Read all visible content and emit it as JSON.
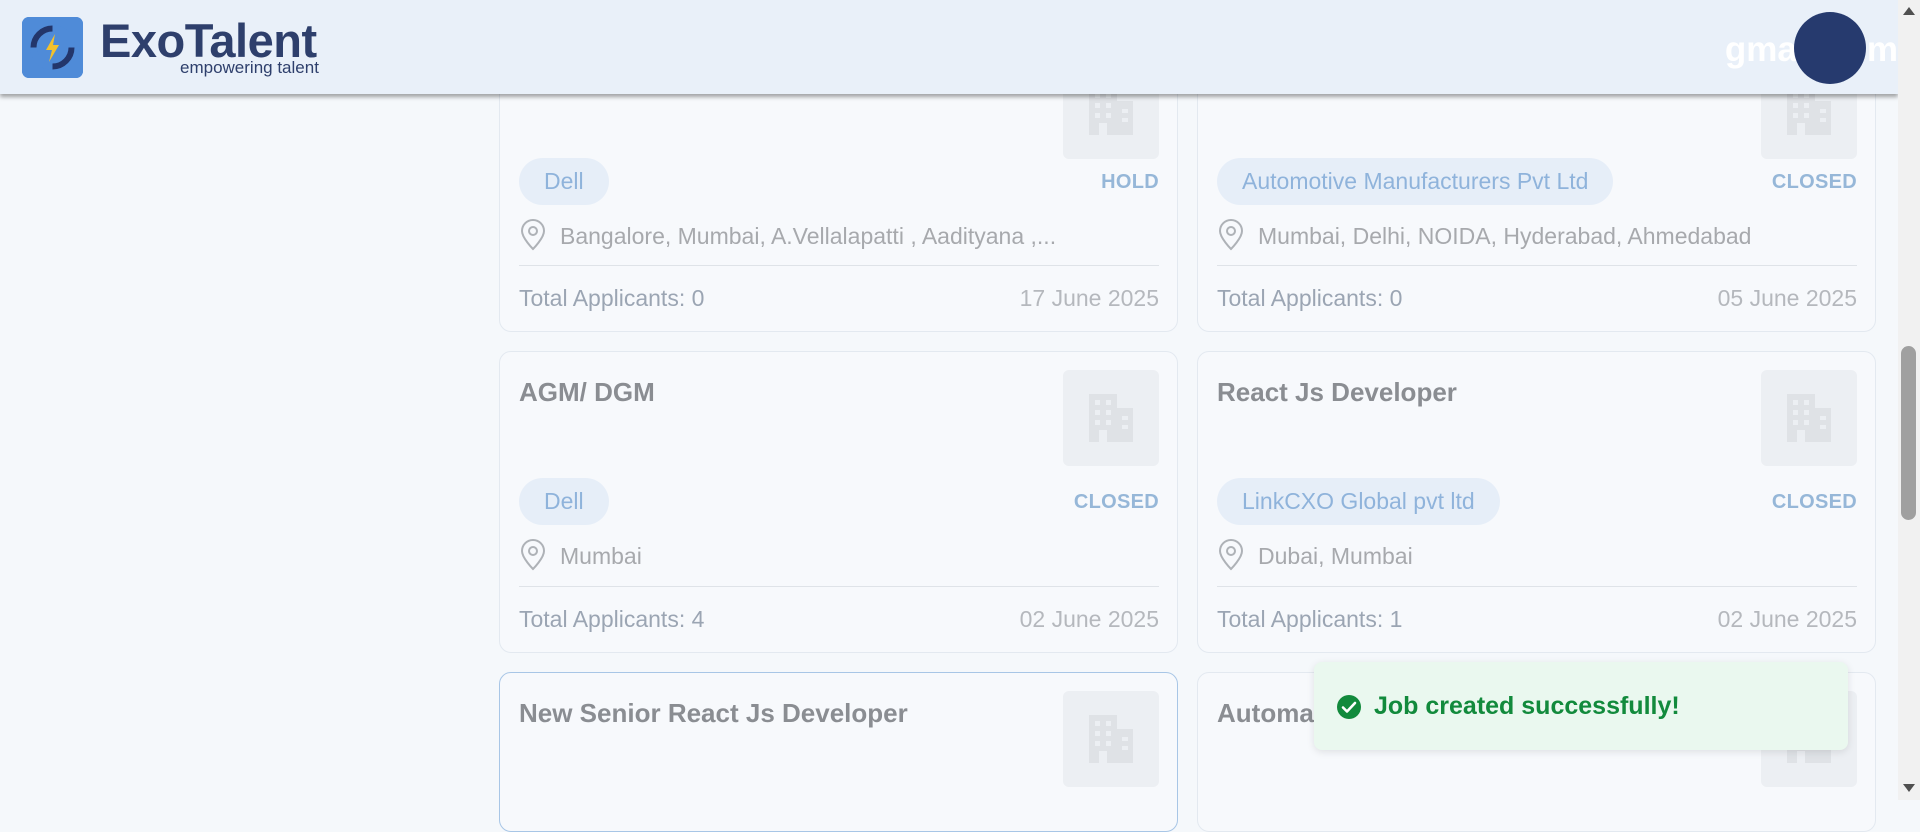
{
  "header": {
    "brand_name": "ExoTalent",
    "brand_tagline": "empowering talent",
    "email_text": "gmail.com"
  },
  "jobs": [
    {
      "title": "",
      "company": "Dell",
      "status": "HOLD",
      "location": "Bangalore, Mumbai, A.Vellalapatti , Aadityana ,...",
      "applicants": "Total Applicants: 0",
      "date": "17 June 2025"
    },
    {
      "title": "",
      "company": "Automotive Manufacturers Pvt Ltd",
      "status": "CLOSED",
      "location": "Mumbai, Delhi, NOIDA, Hyderabad, Ahmedabad",
      "applicants": "Total Applicants: 0",
      "date": "05 June 2025"
    },
    {
      "title": "AGM/ DGM",
      "company": "Dell",
      "status": "CLOSED",
      "location": "Mumbai",
      "applicants": "Total Applicants: 4",
      "date": "02 June 2025"
    },
    {
      "title": "React Js Developer",
      "company": "LinkCXO Global pvt ltd",
      "status": "CLOSED",
      "location": "Dubai, Mumbai",
      "applicants": "Total Applicants: 1",
      "date": "02 June 2025"
    },
    {
      "title": "New Senior React Js Developer"
    },
    {
      "title": "Automa"
    }
  ],
  "toast": {
    "message": "Job created successfully!",
    "color": "#128a3c"
  },
  "colors": {
    "brand": "#2e3f6c",
    "chip_text": "#8fb3db",
    "status_text": "#96b7d8"
  }
}
